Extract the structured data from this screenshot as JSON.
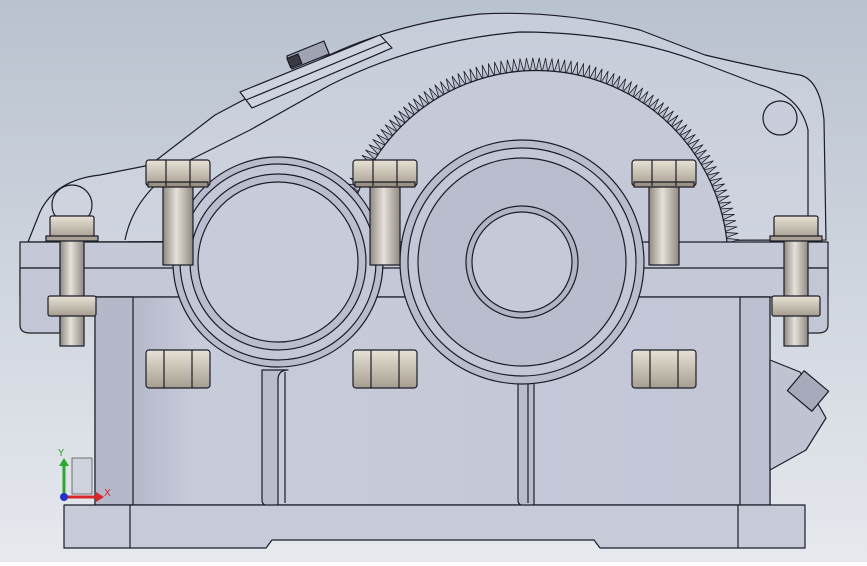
{
  "viewport": {
    "background_top": "#b9c2cf",
    "background_bottom": "#e6e9ee",
    "part_fill": "#c9ccda",
    "part_fill_dark": "#aeb2c3",
    "edge_color": "#1c1c28",
    "cover_fill": "#d3d6e3",
    "bolt_fill": "#cdc7bd",
    "bolt_dark": "#8d8678"
  },
  "triad": {
    "x_label": "X",
    "y_label": "Y",
    "x_color": "#d8262b",
    "y_color": "#2aa832",
    "z_color": "#2233cc"
  }
}
